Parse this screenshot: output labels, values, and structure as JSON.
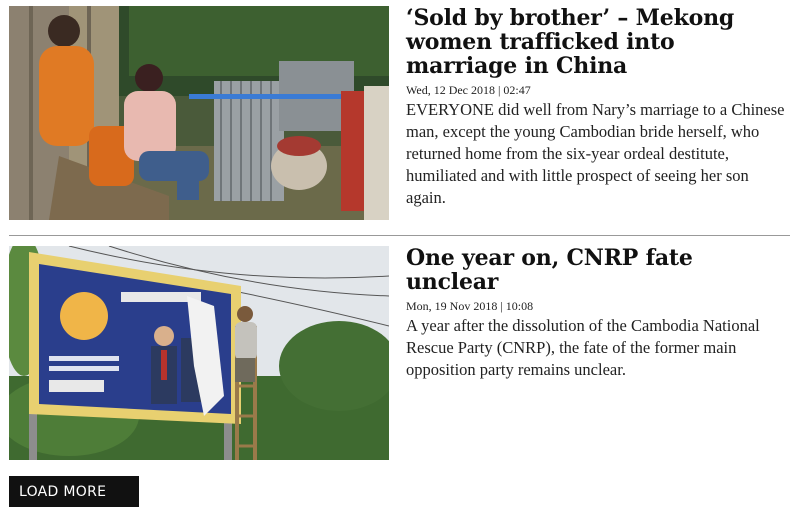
{
  "articles": [
    {
      "headline": "‘Sold by brother’ – Mekong women trafficked into marriage in China",
      "dateline": "Wed, 12 Dec 2018 | 02:47",
      "summary": "EVERYONE did well from Nary’s marriage to a Chinese man, except the young Cambodian bride herself, who returned home from the six-year ordeal destitute, humiliated and with little prospect of seeing her son again."
    },
    {
      "headline": "One year on, CNRP fate unclear",
      "dateline": "Mon, 19 Nov 2018 | 10:08",
      "summary": "A year after the dissolution of the Cambodia National Rescue Party (CNRP), the fate of the former main opposition party remains unclear."
    }
  ],
  "load_more_label": "LOAD MORE"
}
